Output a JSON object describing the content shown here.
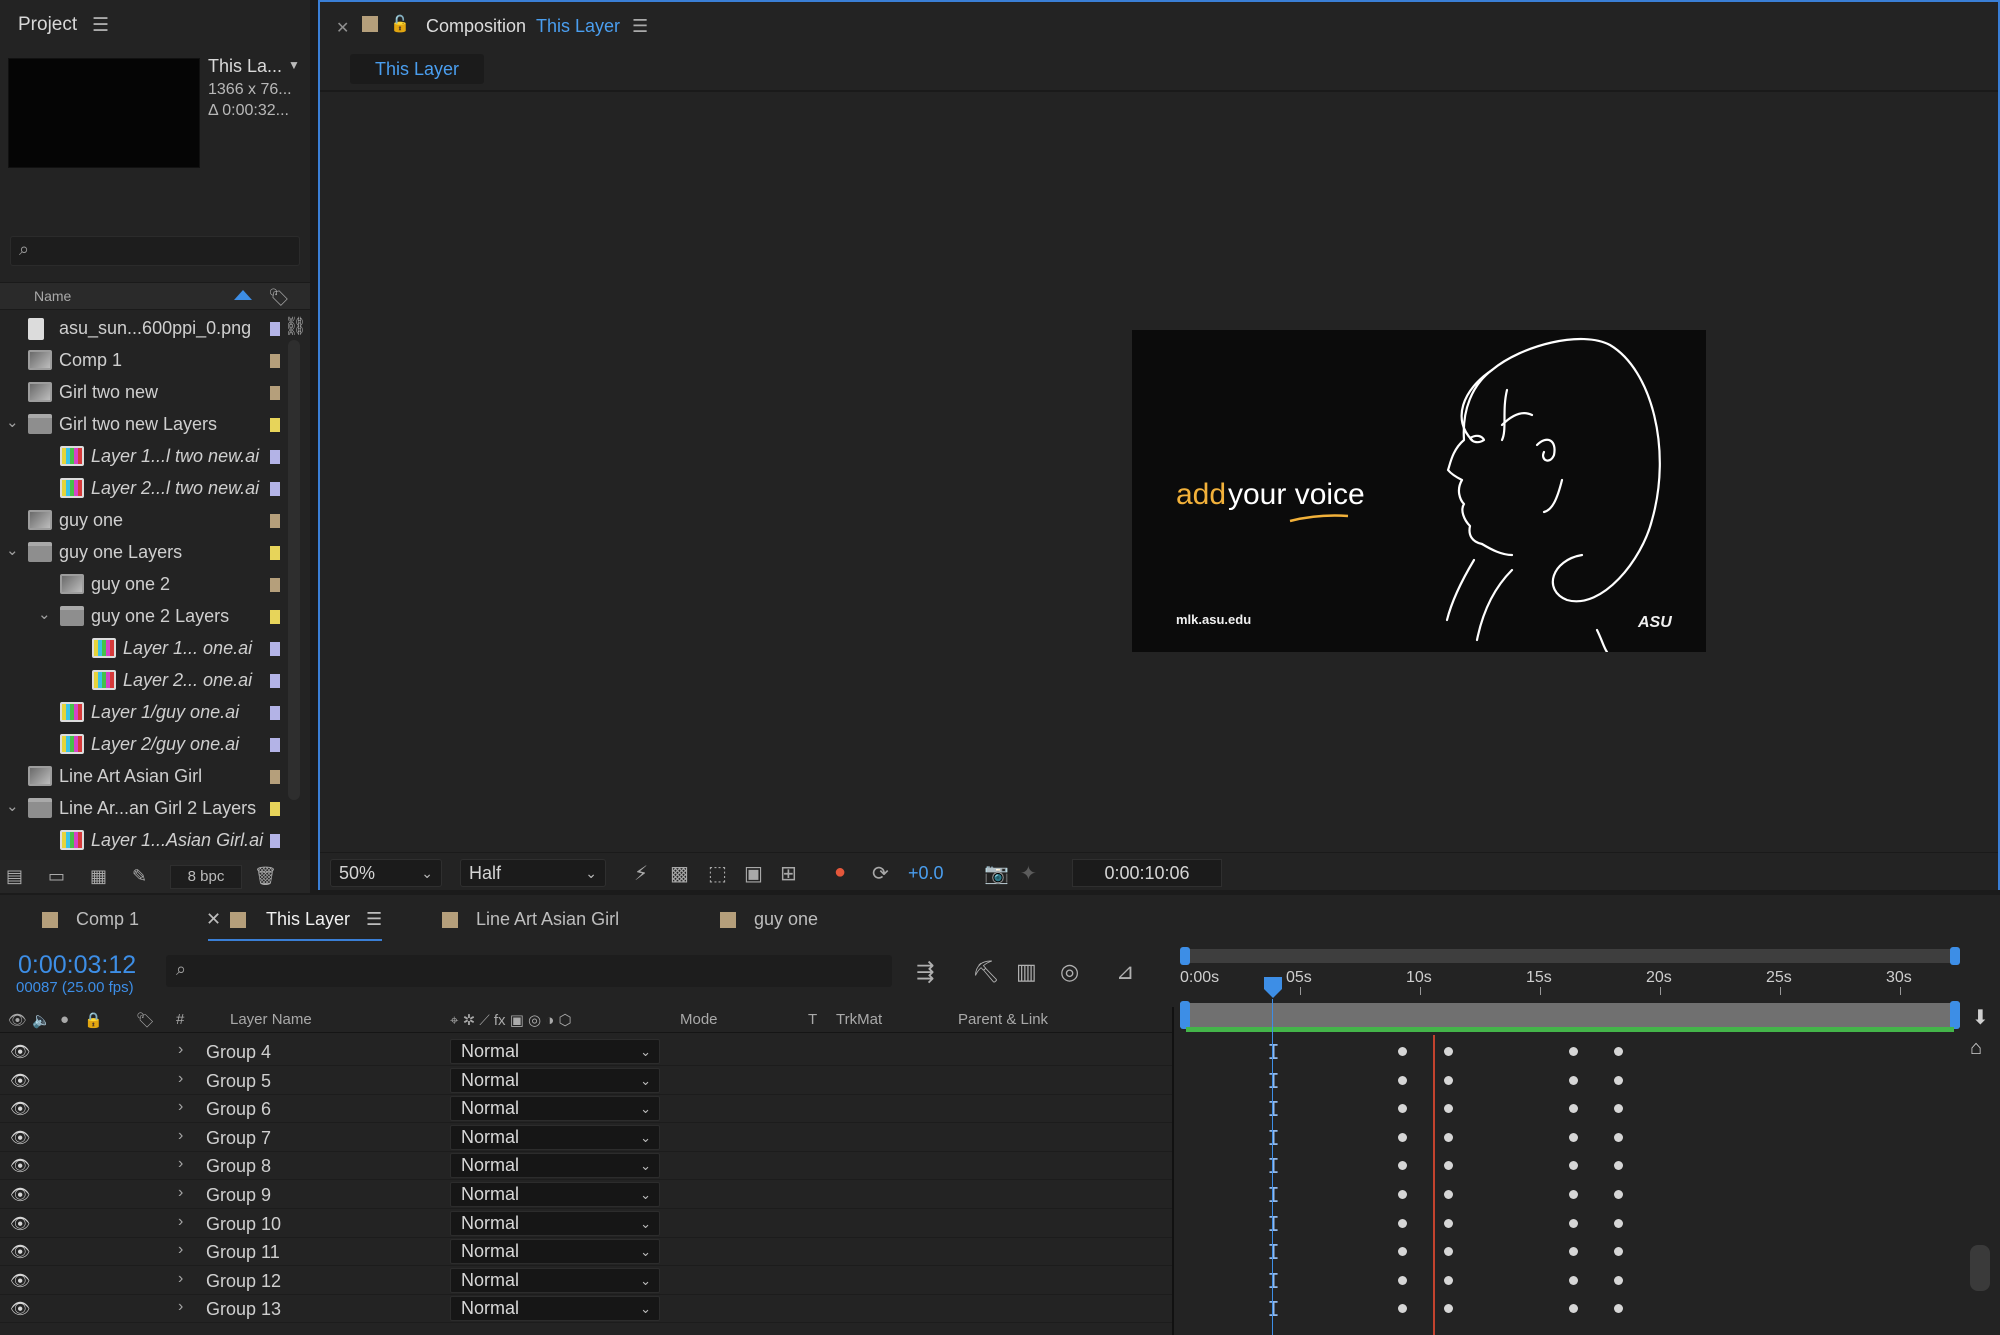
{
  "project": {
    "title": "Project",
    "menu_icon": "hamburger-icon",
    "preview": {
      "name": "This La...",
      "dims": "1366 x 76...",
      "duration": "Δ 0:00:32..."
    },
    "column_name": "Name",
    "items": [
      {
        "label": "asu_sun...600ppi_0.png",
        "type": "png",
        "indent": 0,
        "italic": false,
        "twirl": "",
        "swatch": "#b3b3e6"
      },
      {
        "label": "Comp 1",
        "type": "comp",
        "indent": 0,
        "italic": false,
        "twirl": "",
        "swatch": "#b59f7b"
      },
      {
        "label": "Girl two new",
        "type": "comp",
        "indent": 0,
        "italic": false,
        "twirl": "",
        "swatch": "#b59f7b"
      },
      {
        "label": "Girl two new Layers",
        "type": "folder",
        "indent": 0,
        "italic": false,
        "twirl": "open",
        "swatch": "#e7d45a"
      },
      {
        "label": "Layer 1...l two new.ai",
        "type": "ai",
        "indent": 1,
        "italic": true,
        "twirl": "",
        "swatch": "#b3b3e6"
      },
      {
        "label": "Layer 2...l two new.ai",
        "type": "ai",
        "indent": 1,
        "italic": true,
        "twirl": "",
        "swatch": "#b3b3e6"
      },
      {
        "label": "guy one",
        "type": "comp",
        "indent": 0,
        "italic": false,
        "twirl": "",
        "swatch": "#b59f7b"
      },
      {
        "label": "guy one Layers",
        "type": "folder",
        "indent": 0,
        "italic": false,
        "twirl": "open",
        "swatch": "#e7d45a"
      },
      {
        "label": "guy one 2",
        "type": "comp",
        "indent": 1,
        "italic": false,
        "twirl": "",
        "swatch": "#b59f7b"
      },
      {
        "label": "guy one 2 Layers",
        "type": "folder",
        "indent": 1,
        "italic": false,
        "twirl": "open",
        "swatch": "#e7d45a"
      },
      {
        "label": "Layer 1... one.ai",
        "type": "ai",
        "indent": 2,
        "italic": true,
        "twirl": "",
        "swatch": "#b3b3e6"
      },
      {
        "label": "Layer 2... one.ai",
        "type": "ai",
        "indent": 2,
        "italic": true,
        "twirl": "",
        "swatch": "#b3b3e6"
      },
      {
        "label": "Layer 1/guy one.ai",
        "type": "ai",
        "indent": 1,
        "italic": true,
        "twirl": "",
        "swatch": "#b3b3e6"
      },
      {
        "label": "Layer 2/guy one.ai",
        "type": "ai",
        "indent": 1,
        "italic": true,
        "twirl": "",
        "swatch": "#b3b3e6"
      },
      {
        "label": "Line Art Asian Girl",
        "type": "comp",
        "indent": 0,
        "italic": false,
        "twirl": "",
        "swatch": "#b59f7b"
      },
      {
        "label": "Line Ar...an Girl 2 Layers",
        "type": "folder",
        "indent": 0,
        "italic": false,
        "twirl": "open",
        "swatch": "#e7d45a"
      },
      {
        "label": "Layer 1...Asian Girl.ai",
        "type": "ai",
        "indent": 1,
        "italic": true,
        "twirl": "",
        "swatch": "#b3b3e6"
      }
    ],
    "bpc": "8 bpc"
  },
  "viewer": {
    "panel_label": "Composition",
    "comp_name": "This Layer",
    "flow_tab": "This Layer",
    "stage": {
      "tagline_accent": "add",
      "tagline_rest": "your voice",
      "url": "mlk.asu.edu",
      "logo": "ASU"
    },
    "zoom": "50%",
    "resolution": "Half",
    "exposure": "+0.0",
    "timecode": "0:00:10:06"
  },
  "timeline": {
    "tabs": [
      {
        "label": "Comp 1",
        "active": false,
        "closable": false
      },
      {
        "label": "This Layer",
        "active": true,
        "closable": true
      },
      {
        "label": "Line Art Asian Girl",
        "active": false,
        "closable": false
      },
      {
        "label": "guy one",
        "active": false,
        "closable": false
      }
    ],
    "current_time": "0:00:03:12",
    "frame_info": "00087 (25.00 fps)",
    "columns": {
      "num": "#",
      "layer_name": "Layer Name",
      "mode": "Mode",
      "t": "T",
      "trkmat": "TrkMat",
      "parent": "Parent & Link"
    },
    "ruler_labels": [
      "0:00s",
      "05s",
      "10s",
      "15s",
      "20s",
      "25s",
      "30s"
    ],
    "layers": [
      {
        "name": "Group 4",
        "mode": "Normal"
      },
      {
        "name": "Group 5",
        "mode": "Normal"
      },
      {
        "name": "Group 6",
        "mode": "Normal"
      },
      {
        "name": "Group 7",
        "mode": "Normal"
      },
      {
        "name": "Group 8",
        "mode": "Normal"
      },
      {
        "name": "Group 9",
        "mode": "Normal"
      },
      {
        "name": "Group 10",
        "mode": "Normal"
      },
      {
        "name": "Group 11",
        "mode": "Normal"
      },
      {
        "name": "Group 12",
        "mode": "Normal"
      },
      {
        "name": "Group 13",
        "mode": "Normal"
      }
    ],
    "playhead_time_s": 3.48,
    "keyframe_times_s": [
      9.1,
      11.0,
      16.2,
      18.1
    ]
  },
  "colors": {
    "accent": "#3d8ee6",
    "label_comp": "#b59f7b",
    "label_ai": "#b3b3e6",
    "label_folder": "#e7d45a",
    "tagline_accent": "#f2b13a",
    "cache_bar": "#44b54a",
    "marker_red": "#c2432e"
  }
}
